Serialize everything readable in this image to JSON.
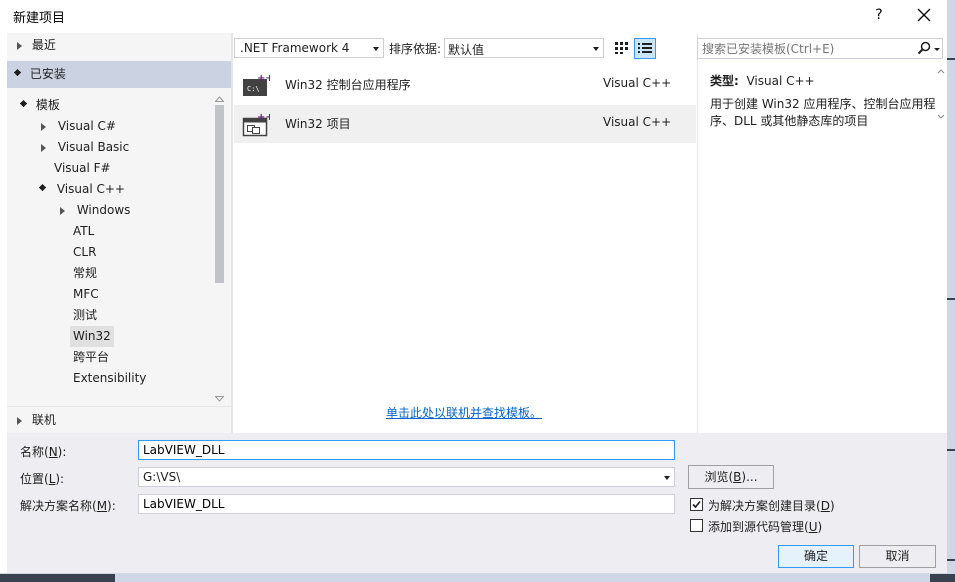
{
  "window": {
    "title": "新建项目",
    "help_label": "?"
  },
  "left_panel": {
    "recent": "最近",
    "installed": "已安装",
    "tree": [
      {
        "label": "模板"
      },
      {
        "label": "Visual C#"
      },
      {
        "label": "Visual Basic"
      },
      {
        "label": "Visual F#"
      },
      {
        "label": "Visual C++"
      },
      {
        "label": "Windows"
      },
      {
        "label": "ATL"
      },
      {
        "label": "CLR"
      },
      {
        "label": "常规"
      },
      {
        "label": "MFC"
      },
      {
        "label": "测试"
      },
      {
        "label": "Win32"
      },
      {
        "label": "跨平台"
      },
      {
        "label": "Extensibility"
      }
    ],
    "online": "联机"
  },
  "toolbar": {
    "framework": ".NET Framework 4",
    "sort_label": "排序依据:",
    "sort_value": "默认值"
  },
  "templates": [
    {
      "name": "Win32 控制台应用程序",
      "language": "Visual C++",
      "icon": "console-app-icon"
    },
    {
      "name": "Win32 项目",
      "language": "Visual C++",
      "icon": "win32-project-icon"
    }
  ],
  "online_link": "单击此处以联机并查找模板。",
  "search": {
    "placeholder": "搜索已安装模板(Ctrl+E)"
  },
  "details": {
    "type_label": "类型:",
    "type_value": "Visual C++",
    "description": "用于创建 Win32 应用程序、控制台应用程序、DLL 或其他静态库的项目"
  },
  "form": {
    "name_label": "名称(",
    "name_key": "N",
    "name_label_end": "):",
    "name_value": "LabVIEW_DLL",
    "location_label": "位置(",
    "location_key": "L",
    "location_label_end": "):",
    "location_value": "G:\\VS\\",
    "solution_label": "解决方案名称(",
    "solution_key": "M",
    "solution_label_end": "):",
    "solution_value": "LabVIEW_DLL",
    "browse_label": "浏览(",
    "browse_key": "B",
    "browse_label_end": ")...",
    "create_dir_label": "为解决方案创建目录(",
    "create_dir_key": "D",
    "create_dir_end": ")",
    "create_dir_checked": true,
    "source_control_label": "添加到源代码管理(",
    "source_control_key": "U",
    "source_control_end": ")",
    "source_control_checked": false
  },
  "buttons": {
    "ok": "确定",
    "cancel": "取消"
  },
  "colors": {
    "accent": "#3399ff",
    "link": "#0066cc",
    "selected_section": "#cbd3e3"
  }
}
